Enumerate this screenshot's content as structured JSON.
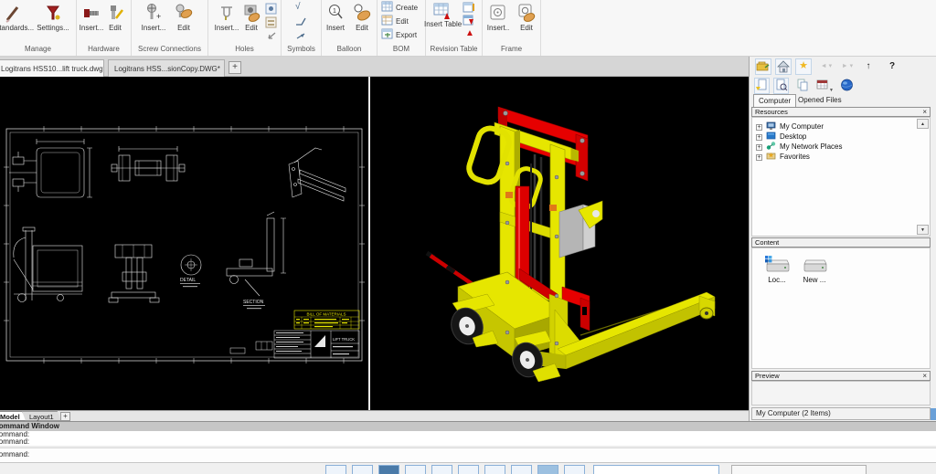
{
  "ribbon": {
    "groups": [
      {
        "label": "Manage",
        "buttons": [
          {
            "label": "Standards..."
          },
          {
            "label": "Settings..."
          }
        ]
      },
      {
        "label": "Hardware",
        "buttons": [
          {
            "label": "Insert..."
          },
          {
            "label": "Edit"
          }
        ]
      },
      {
        "label": "Screw Connections",
        "buttons": [
          {
            "label": "Insert..."
          },
          {
            "label": "Edit"
          }
        ]
      },
      {
        "label": "Holes",
        "buttons": [
          {
            "label": "Insert..."
          },
          {
            "label": "Edit"
          }
        ]
      },
      {
        "label": "Symbols",
        "buttons": []
      },
      {
        "label": "Balloon",
        "buttons": [
          {
            "label": "Insert"
          },
          {
            "label": "Edit"
          }
        ]
      },
      {
        "label": "BOM",
        "buttons": [
          {
            "label": "Create"
          },
          {
            "label": "Edit"
          },
          {
            "label": "Export"
          }
        ]
      },
      {
        "label": "Revision Table",
        "buttons": [
          {
            "label": "Insert Table"
          }
        ]
      },
      {
        "label": "Frame",
        "buttons": [
          {
            "label": "Insert.."
          },
          {
            "label": "Edit"
          }
        ]
      }
    ]
  },
  "doc_tabs": {
    "tabs": [
      {
        "label": "Logitrans HSS10...lift truck.dwg*"
      },
      {
        "label": "Logitrans HSS...sionCopy.DWG*"
      }
    ]
  },
  "glyphs": {
    "close": "×",
    "plus": "+",
    "help": "?",
    "up_arrow": "↑",
    "back": "◄ ▾",
    "forward": "► ▾",
    "dropdown": "▼",
    "check": "√",
    "warning": "▲",
    "scroll_up": "▲",
    "scroll_down": "▼",
    "star": "★",
    "balloon_one": "1",
    "expand": "+"
  },
  "drawing_sheet": {
    "bom_title": "BILL OF MATERIALS",
    "detail_label": "DETAIL",
    "section_label": "SECTION",
    "title_block_text": "LIFT TRUCK"
  },
  "side_panel": {
    "tabs": [
      {
        "label": "Computer"
      },
      {
        "label": "Opened Files"
      }
    ],
    "resources": {
      "title": "Resources",
      "items": [
        {
          "label": "My Computer"
        },
        {
          "label": "Desktop"
        },
        {
          "label": "My Network Places"
        },
        {
          "label": "Favorites"
        }
      ]
    },
    "content": {
      "title": "Content",
      "items": [
        {
          "label": "Loc..."
        },
        {
          "label": "New ..."
        }
      ]
    },
    "preview": {
      "title": "Preview"
    },
    "status": "My Computer (2 Items)"
  },
  "model_tabs": {
    "tabs": [
      {
        "label": "Model"
      },
      {
        "label": "Layout1"
      }
    ]
  },
  "command_window": {
    "title": "Command Window",
    "history": [
      {
        "text": "Command:"
      },
      {
        "text": "Command:"
      }
    ],
    "input": "Command:"
  },
  "colors": {
    "canvas_bg": "#000000",
    "model_yellow": "#e6e600",
    "model_red": "#e60000",
    "bom_yellow": "#e8e800",
    "accent_blue": "#78a6d4"
  }
}
